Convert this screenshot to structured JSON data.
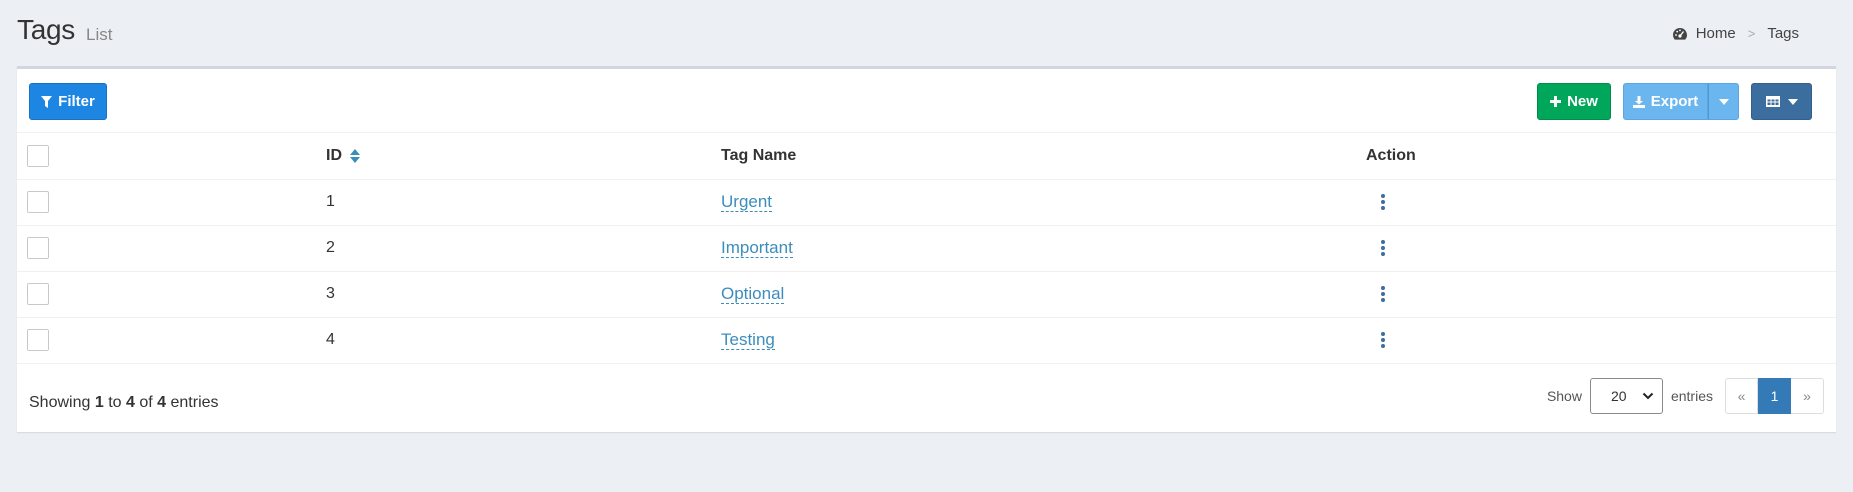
{
  "header": {
    "title": "Tags",
    "subtitle": "List",
    "breadcrumb": [
      {
        "label": "Home",
        "icon": "dashboard-icon"
      },
      {
        "label": "Tags"
      }
    ],
    "separator": ">"
  },
  "toolbar": {
    "filter_label": "Filter",
    "new_label": "New",
    "export_label": "Export",
    "colors": {
      "filter": "#1d86e3",
      "new": "#00a65a",
      "export": "#6cb6f0",
      "columns": "#3c6d9f"
    }
  },
  "table": {
    "columns": [
      "ID",
      "Tag Name",
      "Action"
    ],
    "rows": [
      {
        "id": "1",
        "name": "Urgent"
      },
      {
        "id": "2",
        "name": "Important"
      },
      {
        "id": "3",
        "name": "Optional"
      },
      {
        "id": "4",
        "name": "Testing"
      }
    ]
  },
  "footer": {
    "showing_prefix": "Showing",
    "from": "1",
    "to_word": "to",
    "to": "4",
    "of_word": "of",
    "total": "4",
    "entries_word": "entries",
    "show_label": "Show",
    "per_page": "20",
    "entries_label": "entries",
    "pager_prev": "«",
    "pager_current": "1",
    "pager_next": "»"
  }
}
